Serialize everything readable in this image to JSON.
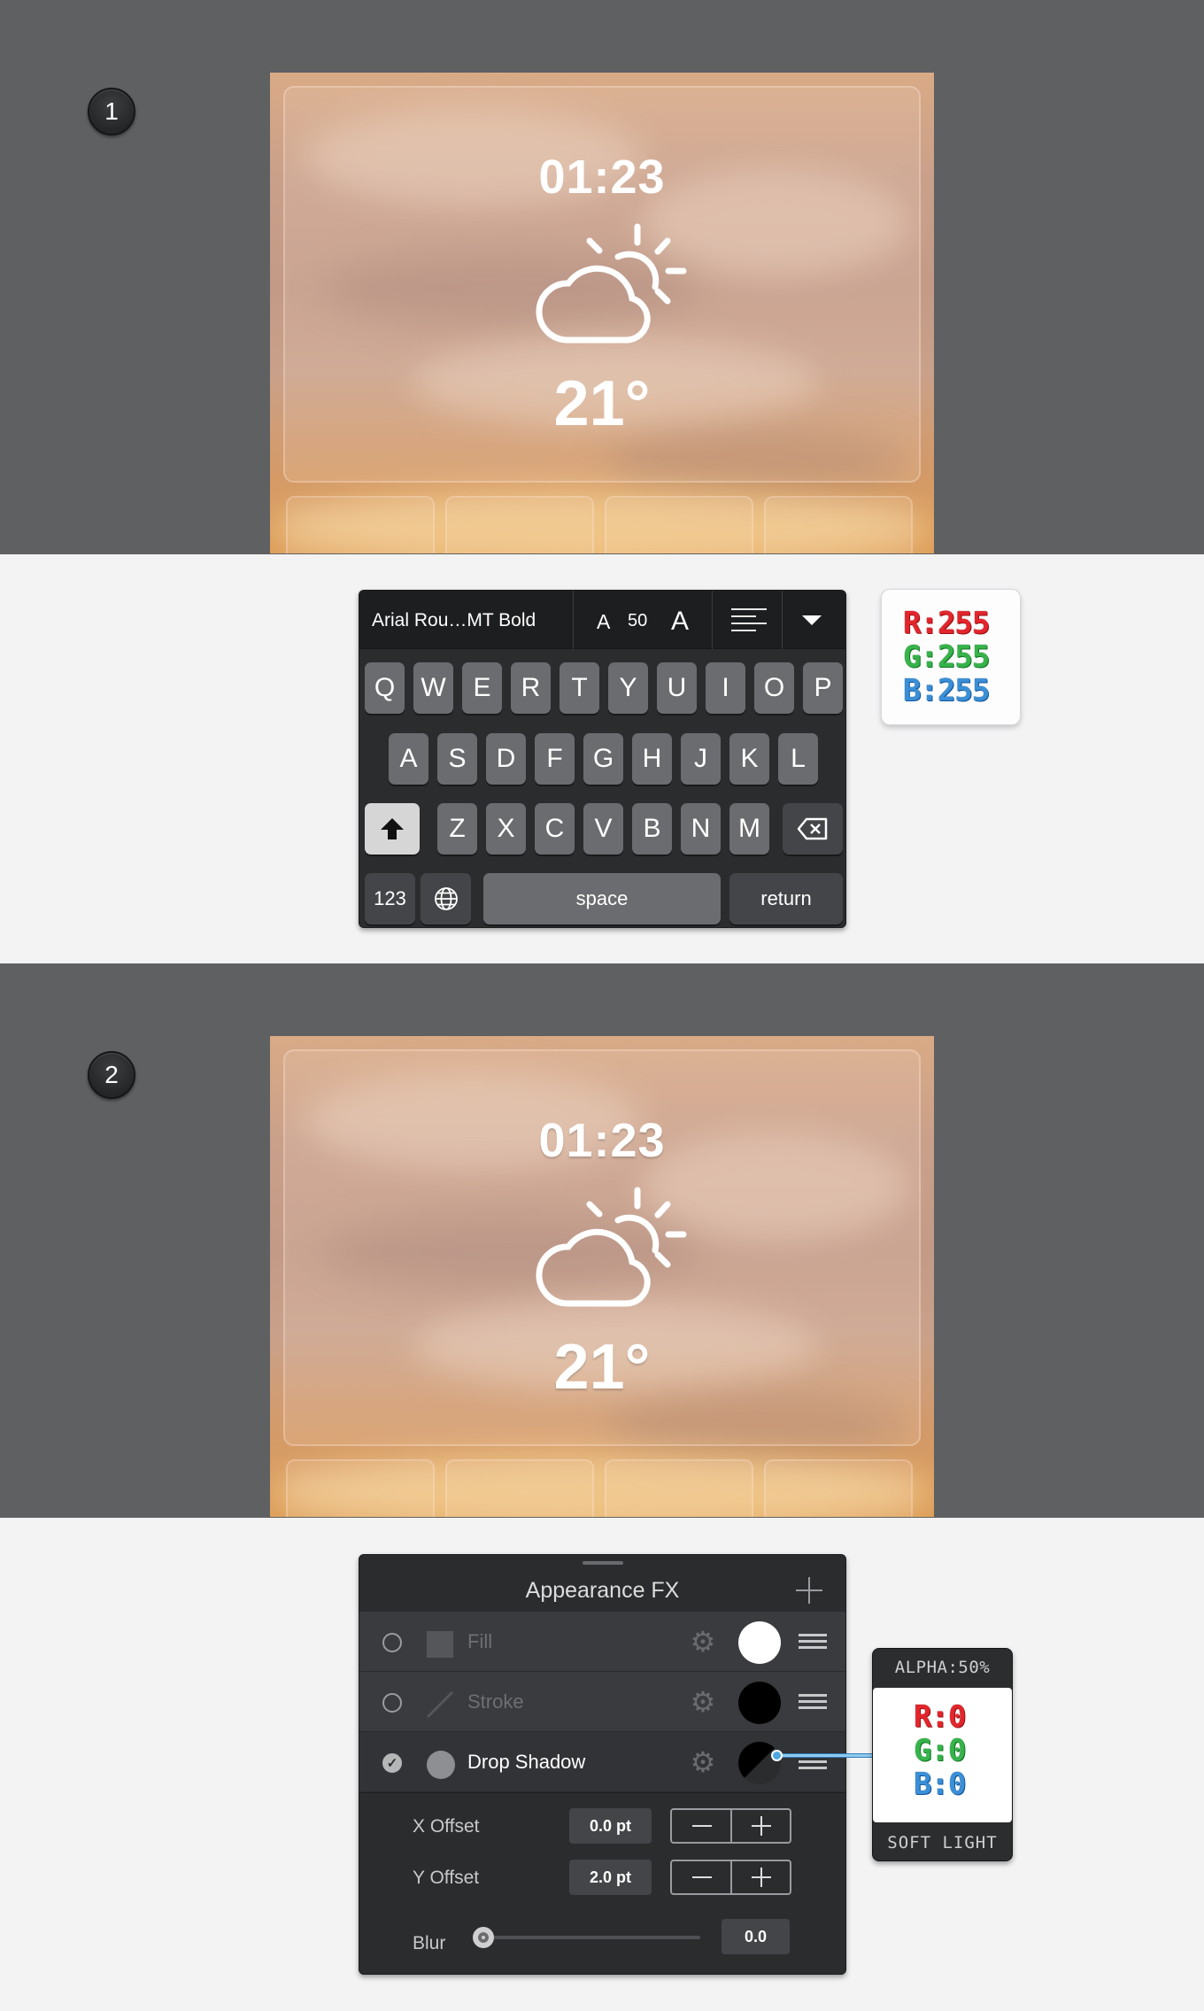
{
  "steps": {
    "step1": "1",
    "step2": "2"
  },
  "widget": {
    "time": "01:23",
    "temperature": "21°",
    "weather_icon": "partly-cloudy-icon"
  },
  "keyboard_toolbar": {
    "font_name": "Arial Rou…MT Bold",
    "decrease_label": "A",
    "font_size": "50",
    "increase_label": "A",
    "align_icon": "align-left-icon",
    "more_icon": "caret-down-icon"
  },
  "keyboard": {
    "row1": [
      "Q",
      "W",
      "E",
      "R",
      "T",
      "Y",
      "U",
      "I",
      "O",
      "P"
    ],
    "row2": [
      "A",
      "S",
      "D",
      "F",
      "G",
      "H",
      "J",
      "K",
      "L"
    ],
    "row3": [
      "Z",
      "X",
      "C",
      "V",
      "B",
      "N",
      "M"
    ],
    "numbers": "123",
    "space": "space",
    "return": "return",
    "shift_icon": "shift-icon",
    "globe_icon": "globe-icon",
    "backspace_icon": "backspace-icon"
  },
  "color_card_1": {
    "r": "R:255",
    "g": "G:255",
    "b": "B:255"
  },
  "appearance_fx": {
    "title": "Appearance FX",
    "add_icon": "plus-icon",
    "rows": [
      {
        "label": "Fill",
        "enabled": false,
        "swatch_color": "#ffffff"
      },
      {
        "label": "Stroke",
        "enabled": false,
        "swatch_color": "#000000"
      },
      {
        "label": "Drop Shadow",
        "enabled": true,
        "swatch_color": "#000000"
      }
    ],
    "x_offset": {
      "label": "X Offset",
      "value": "0.0 pt"
    },
    "y_offset": {
      "label": "Y Offset",
      "value": "2.0 pt"
    },
    "blur": {
      "label": "Blur",
      "value": "0.0",
      "level": 0
    }
  },
  "color_card_2": {
    "alpha": "ALPHA:50%",
    "r": "R:0",
    "g": "G:0",
    "b": "B:0",
    "blend_mode": "SOFT LIGHT"
  },
  "colors": {
    "band": "#5f6062",
    "panel": "#2b2c2e",
    "accent_link": "#4fa7e0"
  }
}
